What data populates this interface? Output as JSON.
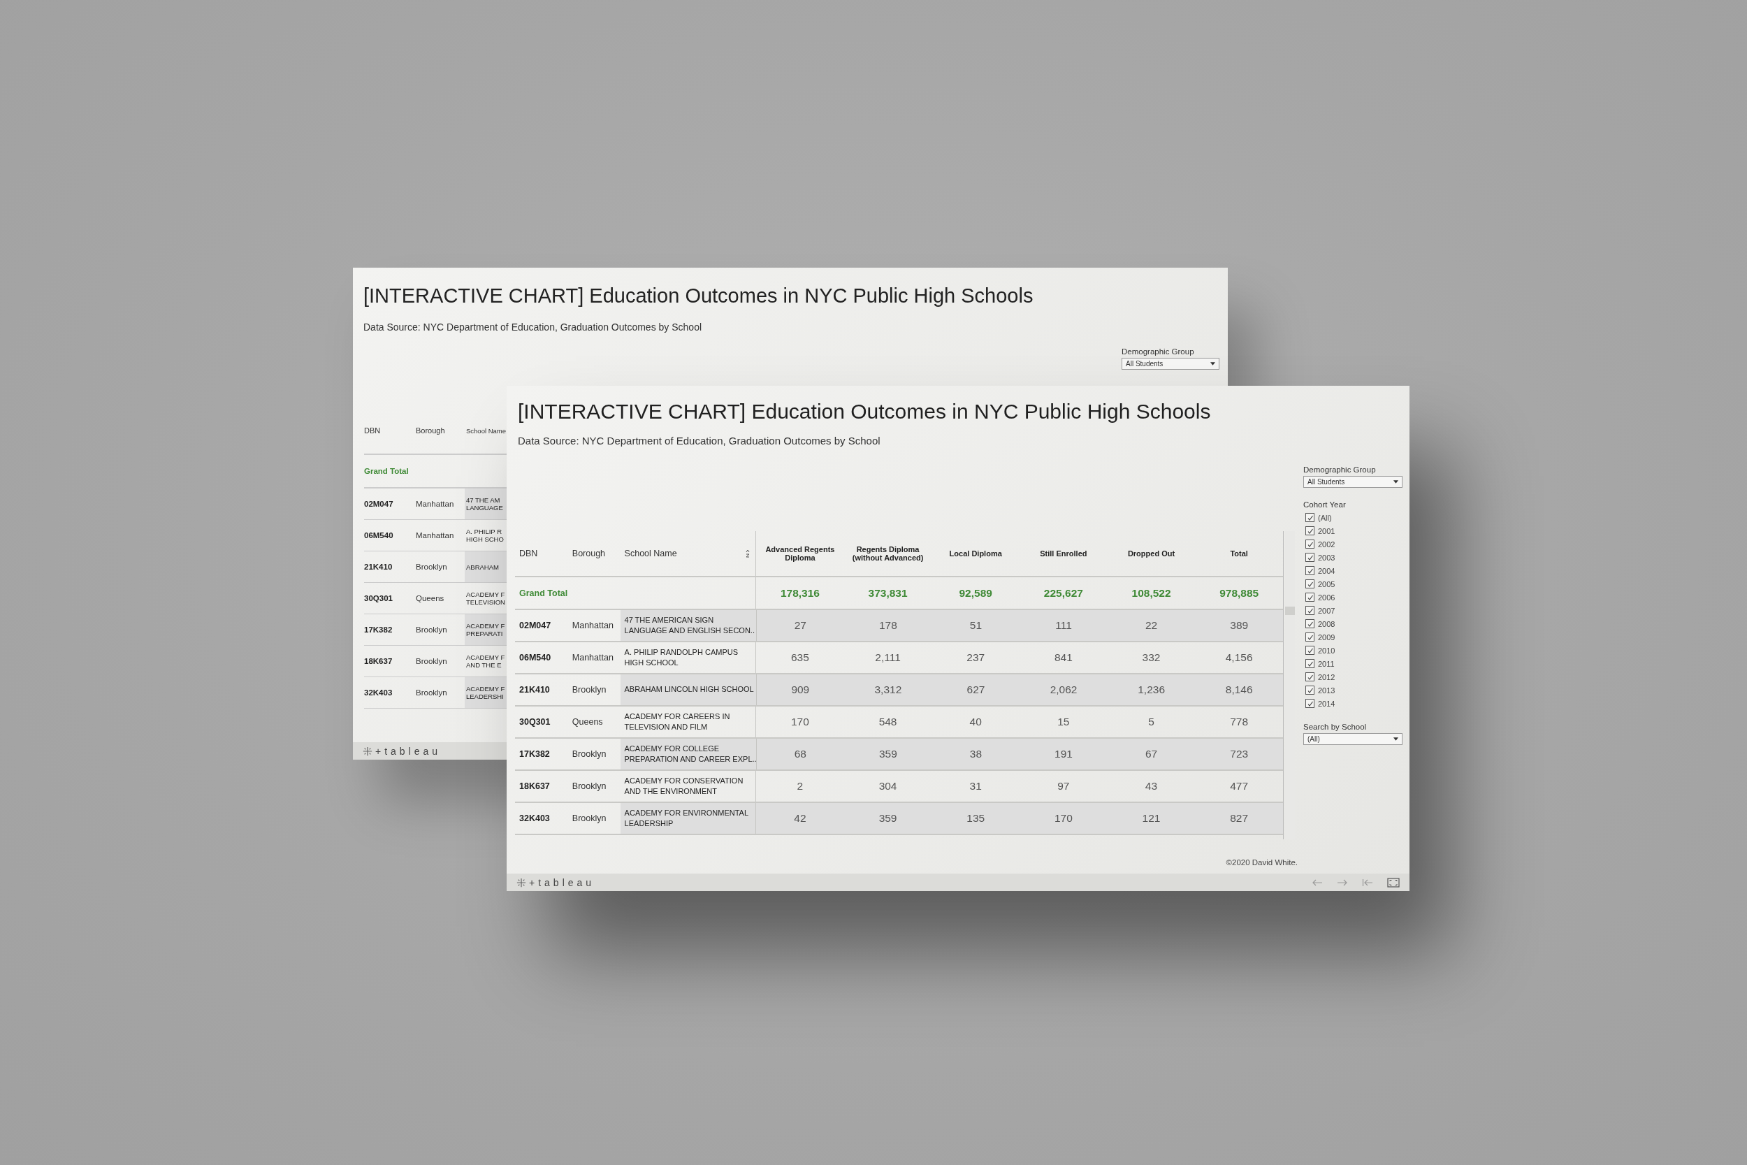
{
  "back_window": {
    "title": "[INTERACTIVE CHART] Education Outcomes in NYC Public High Schools",
    "source": "Data Source: NYC Department of Education, Graduation Outcomes by School",
    "filter": {
      "label": "Demographic Group",
      "value": "All Students"
    },
    "columns": [
      "DBN",
      "Borough",
      "School Name"
    ],
    "grand_total_label": "Grand Total",
    "rows": [
      {
        "dbn": "02M047",
        "borough": "Manhattan",
        "school_lines": [
          "47 THE AM",
          "LANGUAGE"
        ]
      },
      {
        "dbn": "06M540",
        "borough": "Manhattan",
        "school_lines": [
          "A. PHILIP R",
          "HIGH SCHO"
        ]
      },
      {
        "dbn": "21K410",
        "borough": "Brooklyn",
        "school_lines": [
          "ABRAHAM"
        ]
      },
      {
        "dbn": "30Q301",
        "borough": "Queens",
        "school_lines": [
          "ACADEMY F",
          "TELEVISION"
        ]
      },
      {
        "dbn": "17K382",
        "borough": "Brooklyn",
        "school_lines": [
          "ACADEMY F",
          "PREPARATI"
        ]
      },
      {
        "dbn": "18K637",
        "borough": "Brooklyn",
        "school_lines": [
          "ACADEMY F",
          "AND THE E"
        ]
      },
      {
        "dbn": "32K403",
        "borough": "Brooklyn",
        "school_lines": [
          "ACADEMY F",
          "LEADERSHI"
        ]
      }
    ],
    "logo": "+tableau"
  },
  "front_window": {
    "title": "[INTERACTIVE CHART] Education Outcomes in NYC Public High Schools",
    "source": "Data Source: NYC Department of Education, Graduation Outcomes by School",
    "columns": [
      "DBN",
      "Borough",
      "School Name"
    ],
    "value_columns": [
      [
        "Advanced Regents",
        "Diploma"
      ],
      [
        "Regents Diploma",
        "(without Advanced)"
      ],
      [
        "Local Diploma"
      ],
      [
        "Still Enrolled"
      ],
      [
        "Dropped Out"
      ],
      [
        "Total"
      ]
    ],
    "grand_total": {
      "label": "Grand Total",
      "values": [
        "178,316",
        "373,831",
        "92,589",
        "225,627",
        "108,522",
        "978,885"
      ]
    },
    "rows": [
      {
        "dbn": "02M047",
        "borough": "Manhattan",
        "school_lines": [
          "47 THE AMERICAN SIGN",
          "LANGUAGE AND ENGLISH SECON.."
        ],
        "values": [
          "27",
          "178",
          "51",
          "111",
          "22",
          "389"
        ]
      },
      {
        "dbn": "06M540",
        "borough": "Manhattan",
        "school_lines": [
          "A. PHILIP RANDOLPH CAMPUS",
          "HIGH SCHOOL"
        ],
        "values": [
          "635",
          "2,111",
          "237",
          "841",
          "332",
          "4,156"
        ]
      },
      {
        "dbn": "21K410",
        "borough": "Brooklyn",
        "school_lines": [
          "ABRAHAM LINCOLN HIGH SCHOOL"
        ],
        "values": [
          "909",
          "3,312",
          "627",
          "2,062",
          "1,236",
          "8,146"
        ]
      },
      {
        "dbn": "30Q301",
        "borough": "Queens",
        "school_lines": [
          "ACADEMY FOR CAREERS IN",
          "TELEVISION AND FILM"
        ],
        "values": [
          "170",
          "548",
          "40",
          "15",
          "5",
          "778"
        ]
      },
      {
        "dbn": "17K382",
        "borough": "Brooklyn",
        "school_lines": [
          "ACADEMY FOR COLLEGE",
          "PREPARATION AND CAREER EXPL.."
        ],
        "values": [
          "68",
          "359",
          "38",
          "191",
          "67",
          "723"
        ]
      },
      {
        "dbn": "18K637",
        "borough": "Brooklyn",
        "school_lines": [
          "ACADEMY FOR CONSERVATION",
          "AND THE ENVIRONMENT"
        ],
        "values": [
          "2",
          "304",
          "31",
          "97",
          "43",
          "477"
        ]
      },
      {
        "dbn": "32K403",
        "borough": "Brooklyn",
        "school_lines": [
          "ACADEMY FOR ENVIRONMENTAL",
          "LEADERSHIP"
        ],
        "values": [
          "42",
          "359",
          "135",
          "170",
          "121",
          "827"
        ]
      }
    ],
    "filters": {
      "demographic_label": "Demographic Group",
      "demographic_value": "All Students",
      "cohort_label": "Cohort Year",
      "cohort_years": [
        {
          "label": "(All)",
          "checked": true
        },
        {
          "label": "2001",
          "checked": true
        },
        {
          "label": "2002",
          "checked": true
        },
        {
          "label": "2003",
          "checked": true
        },
        {
          "label": "2004",
          "checked": true
        },
        {
          "label": "2005",
          "checked": true
        },
        {
          "label": "2006",
          "checked": true
        },
        {
          "label": "2007",
          "checked": true
        },
        {
          "label": "2008",
          "checked": true
        },
        {
          "label": "2009",
          "checked": true
        },
        {
          "label": "2010",
          "checked": true
        },
        {
          "label": "2011",
          "checked": true
        },
        {
          "label": "2012",
          "checked": true
        },
        {
          "label": "2013",
          "checked": true
        },
        {
          "label": "2014",
          "checked": true
        }
      ],
      "search_label": "Search by School",
      "search_value": "(All)"
    },
    "copyright": "©2020 David White.",
    "logo": "+tableau"
  }
}
